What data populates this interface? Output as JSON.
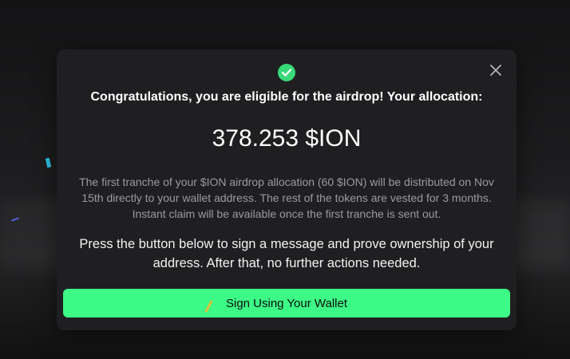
{
  "colors": {
    "accent": "#3dfa86",
    "check": "#39d97a",
    "modal_bg": "#1f1f22",
    "page_bg": "#141416"
  },
  "modal": {
    "icon": "check-circle-icon",
    "close_icon": "close-icon",
    "heading": "Congratulations, you are eligible for the airdrop! Your allocation:",
    "amount": "378.253 $ION",
    "description": "The first tranche of your $ION airdrop allocation (60 $ION) will be distributed on Nov 15th directly to your wallet address. The rest of the tokens are vested for 3 months. Instant claim will be available once the first tranche is sent out.",
    "instruction": "Press the button below to sign a message and prove ownership of your address. After that, no further actions needed.",
    "button_label": "Sign Using Your Wallet"
  }
}
